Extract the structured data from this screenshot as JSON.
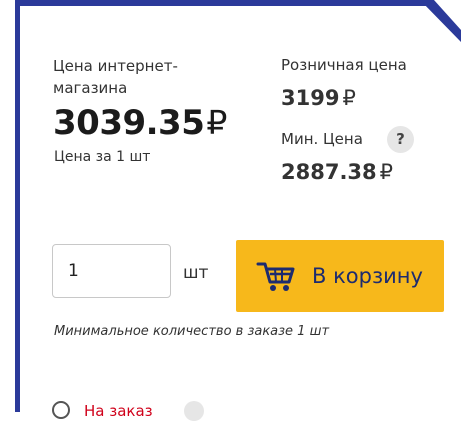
{
  "pricing": {
    "online_label": "Цена интернет-магазина",
    "online_label_line1": "Цена интернет-",
    "online_label_line2": "магазина",
    "online_price": "3039.35",
    "currency_symbol": "₽",
    "per_unit": "Цена за 1 шт",
    "retail_label": "Розничная цена",
    "retail_price": "3199",
    "min_label": "Мин. Цена",
    "min_help": "?",
    "min_price": "2887.38"
  },
  "cart": {
    "quantity": "1",
    "unit": "шт",
    "button_label": "В корзину",
    "min_note": "Минимальное количество в заказе 1 шт"
  },
  "order_option": {
    "label": "На заказ"
  },
  "colors": {
    "accent_border": "#2b3a9a",
    "button_bg": "#f7b81b",
    "button_text": "#1d2b6f",
    "order_label": "#d0021b"
  },
  "icons": {
    "cart": "cart-icon",
    "help": "question-icon",
    "radio": "radio-icon"
  }
}
